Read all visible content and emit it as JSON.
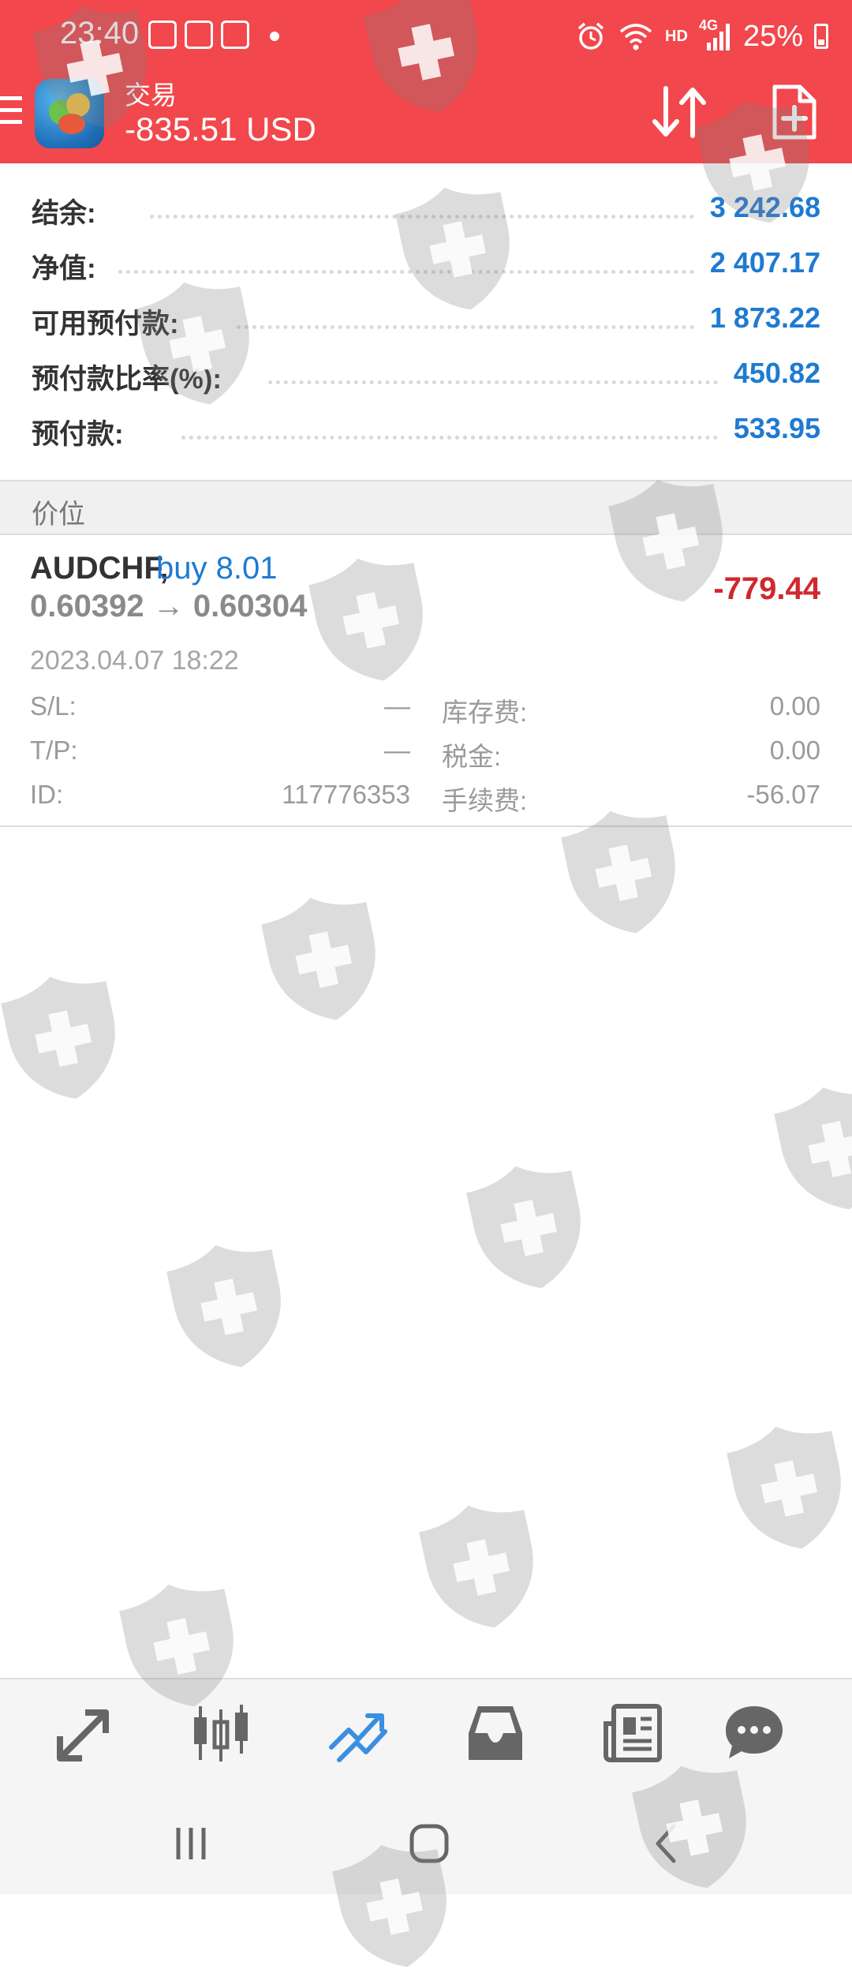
{
  "status_bar": {
    "time": "23:40",
    "network": "HD",
    "signal": "4G",
    "battery": "25%",
    "icons": [
      "baidu-notif-icon",
      "calendar-notif-icon",
      "calendar-notif-icon",
      "alarm-icon",
      "wifi-icon",
      "signal-icon",
      "battery-icon"
    ]
  },
  "toolbar": {
    "title": "交易",
    "subtitle": "-835.51 USD",
    "accent_color": "#f2474c",
    "icons": [
      "menu-icon",
      "metatrader-logo-icon",
      "sort-icon",
      "new-order-icon"
    ]
  },
  "account": {
    "rows": [
      {
        "label": "结余:",
        "value": "3 242.68"
      },
      {
        "label": "净值:",
        "value": "2 407.17"
      },
      {
        "label": "可用预付款:",
        "value": "1 873.22"
      },
      {
        "label": "预付款比率(%):",
        "value": "450.82"
      },
      {
        "label": "预付款:",
        "value": "533.95"
      }
    ],
    "value_color": "#1f7ad1"
  },
  "section": {
    "title": "价位"
  },
  "position": {
    "symbol": "AUDCHF,",
    "side": "buy 8.01",
    "prices": "0.60392 → 0.60304",
    "profit": "-779.44",
    "profit_color": "#d0282e",
    "time": "2023.04.07 18:22",
    "sl_label": "S/L:",
    "sl_value": "—",
    "tp_label": "T/P:",
    "tp_value": "—",
    "id_label": "ID:",
    "id_value": "117776353",
    "swap_label": "库存费:",
    "swap_value": "0.00",
    "tax_label": "税金:",
    "tax_value": "0.00",
    "commission_label": "手续费:",
    "commission_value": "-56.07"
  },
  "bottom_nav": {
    "items": [
      "quotes-icon",
      "chart-icon",
      "trade-icon",
      "history-icon",
      "news-icon",
      "messages-icon"
    ],
    "active": "trade-icon",
    "active_color": "#3a8fe0"
  },
  "system_nav": {
    "items": [
      "recents-icon",
      "home-icon",
      "back-icon"
    ]
  }
}
